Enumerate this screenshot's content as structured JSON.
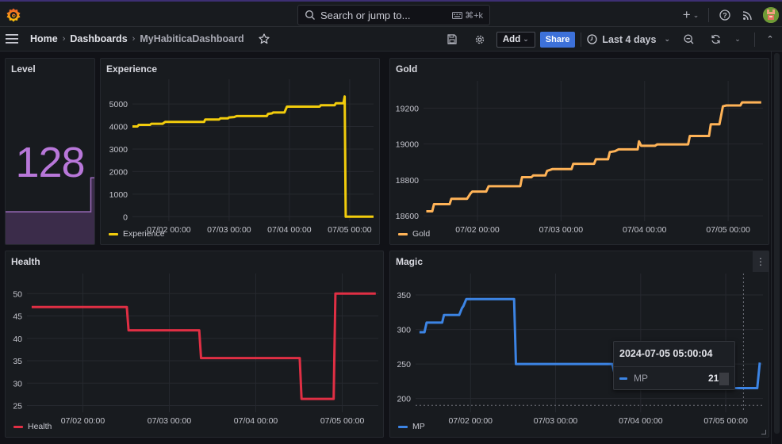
{
  "topbar": {
    "search_placeholder": "Search or jump to...",
    "search_shortcut": "⌘+k",
    "new_button_icon": "plus-icon",
    "help_icon": "help-icon",
    "news_icon": "rss-icon",
    "profile_icon": "avatar"
  },
  "navbar": {
    "breadcrumbs": [
      "Home",
      "Dashboards",
      "MyHabiticaDashboard"
    ],
    "star_icon": "star-icon",
    "add_label": "Add",
    "share_label": "Share",
    "time_range": "Last 4 days"
  },
  "colors": {
    "level": "#b877d9",
    "experience": "#f2cc0c",
    "gold": "#ffb357",
    "health": "#e02f44",
    "magic": "#3c84e4",
    "share_button": "#3d71d9"
  },
  "panels": {
    "level": {
      "title": "Level",
      "value": "128",
      "sparkline": {
        "x_hours": [
          9.5,
          100,
          100,
          105.5
        ],
        "values": [
          127,
          127,
          128,
          128
        ]
      }
    },
    "experience": {
      "title": "Experience",
      "legend": "Experience"
    },
    "gold": {
      "title": "Gold",
      "legend": "Gold"
    },
    "health": {
      "title": "Health",
      "legend": "Health"
    },
    "magic": {
      "title": "Magic",
      "legend": "MP",
      "menu_icon": "kebab-menu-icon"
    }
  },
  "tooltip": {
    "time": "2024-07-05 05:00:04",
    "series": "MP",
    "value": "215"
  },
  "chart_data": [
    {
      "id": "experience",
      "type": "line",
      "title": "Experience",
      "xlabel": "",
      "ylabel": "",
      "x_unit": "hours since 07/01 00:00",
      "xlim": [
        9.5,
        105.5
      ],
      "ylim": [
        -200,
        5600
      ],
      "yticks": [
        0,
        1000,
        2000,
        3000,
        4000,
        5000
      ],
      "xticks": [
        {
          "h": 24,
          "label": "07/02 00:00"
        },
        {
          "h": 48,
          "label": "07/03 00:00"
        },
        {
          "h": 72,
          "label": "07/04 00:00"
        },
        {
          "h": 96,
          "label": "07/05 00:00"
        }
      ],
      "legend": "bottom-left",
      "grid": true,
      "series": [
        {
          "name": "Experience",
          "points": [
            [
              9.5,
              4000
            ],
            [
              11.5,
              4000
            ],
            [
              12,
              4070
            ],
            [
              16.5,
              4070
            ],
            [
              17,
              4120
            ],
            [
              21.5,
              4120
            ],
            [
              22.5,
              4200
            ],
            [
              38,
              4200
            ],
            [
              38.5,
              4310
            ],
            [
              44,
              4310
            ],
            [
              44.5,
              4360
            ],
            [
              47.5,
              4360
            ],
            [
              48,
              4400
            ],
            [
              50,
              4420
            ],
            [
              51,
              4460
            ],
            [
              63,
              4460
            ],
            [
              63.5,
              4560
            ],
            [
              65,
              4580
            ],
            [
              65.5,
              4620
            ],
            [
              70,
              4620
            ],
            [
              71,
              4880
            ],
            [
              84,
              4880
            ],
            [
              84.5,
              4940
            ],
            [
              90,
              4940
            ],
            [
              90.5,
              5030
            ],
            [
              93.5,
              5030
            ],
            [
              94,
              5330
            ],
            [
              94.4,
              0
            ],
            [
              105.5,
              0
            ]
          ]
        }
      ]
    },
    {
      "id": "gold",
      "type": "line",
      "title": "Gold",
      "x_unit": "hours since 07/01 00:00",
      "xlim": [
        8.5,
        106
      ],
      "ylim": [
        18570,
        19290
      ],
      "yticks": [
        18600,
        18800,
        19000,
        19200
      ],
      "xticks": [
        {
          "h": 24,
          "label": "07/02 00:00"
        },
        {
          "h": 48,
          "label": "07/03 00:00"
        },
        {
          "h": 72,
          "label": "07/04 00:00"
        },
        {
          "h": 96,
          "label": "07/05 00:00"
        }
      ],
      "legend": "bottom-left",
      "grid": true,
      "series": [
        {
          "name": "Gold",
          "points": [
            [
              9.3,
              18625
            ],
            [
              11,
              18625
            ],
            [
              11.5,
              18665
            ],
            [
              16,
              18665
            ],
            [
              16.5,
              18695
            ],
            [
              21,
              18695
            ],
            [
              22,
              18725
            ],
            [
              22.5,
              18735
            ],
            [
              26.5,
              18735
            ],
            [
              27.2,
              18765
            ],
            [
              36.3,
              18765
            ],
            [
              36.8,
              18815
            ],
            [
              39.5,
              18815
            ],
            [
              40,
              18825
            ],
            [
              43.5,
              18825
            ],
            [
              44,
              18850
            ],
            [
              45.5,
              18860
            ],
            [
              51,
              18860
            ],
            [
              51.5,
              18890
            ],
            [
              57.5,
              18890
            ],
            [
              58,
              18915
            ],
            [
              61.5,
              18915
            ],
            [
              62,
              18955
            ],
            [
              63.5,
              18960
            ],
            [
              64.5,
              18970
            ],
            [
              70,
              18970
            ],
            [
              70.4,
              19015
            ],
            [
              71,
              18990
            ],
            [
              75,
              18990
            ],
            [
              75.6,
              18998
            ],
            [
              84.5,
              18998
            ],
            [
              85,
              19045
            ],
            [
              90.5,
              19045
            ],
            [
              91,
              19110
            ],
            [
              93.5,
              19110
            ],
            [
              94.5,
              19210
            ],
            [
              95.5,
              19215
            ],
            [
              99.5,
              19215
            ],
            [
              100,
              19232
            ],
            [
              105.5,
              19232
            ]
          ]
        }
      ]
    },
    {
      "id": "health",
      "type": "line",
      "title": "Health",
      "x_unit": "hours since 07/01 00:00",
      "xlim": [
        8.5,
        106
      ],
      "ylim": [
        23.5,
        52
      ],
      "yticks": [
        25,
        30,
        35,
        40,
        45,
        50
      ],
      "xticks": [
        {
          "h": 24,
          "label": "07/02 00:00"
        },
        {
          "h": 48,
          "label": "07/03 00:00"
        },
        {
          "h": 72,
          "label": "07/04 00:00"
        },
        {
          "h": 96,
          "label": "07/05 00:00"
        }
      ],
      "legend": "bottom-left",
      "grid": true,
      "series": [
        {
          "name": "Health",
          "points": [
            [
              9.8,
              47
            ],
            [
              36.2,
              47
            ],
            [
              36.7,
              41.8
            ],
            [
              56.3,
              41.8
            ],
            [
              56.8,
              35.6
            ],
            [
              84.2,
              35.6
            ],
            [
              84.7,
              26.5
            ],
            [
              93.6,
              26.5
            ],
            [
              94.1,
              50
            ],
            [
              105.3,
              50
            ]
          ]
        }
      ]
    },
    {
      "id": "magic",
      "type": "line",
      "title": "Magic",
      "x_unit": "hours since 07/01 00:00",
      "xlim": [
        8.5,
        106.5
      ],
      "ylim": [
        180,
        365
      ],
      "yticks": [
        200,
        250,
        300,
        350
      ],
      "xticks": [
        {
          "h": 24,
          "label": "07/02 00:00"
        },
        {
          "h": 48,
          "label": "07/03 00:00"
        },
        {
          "h": 72,
          "label": "07/04 00:00"
        },
        {
          "h": 96,
          "label": "07/05 00:00"
        }
      ],
      "legend": "bottom-left",
      "grid": true,
      "crosshair": {
        "h": 101,
        "value": 190
      },
      "series": [
        {
          "name": "MP",
          "points": [
            [
              9.6,
              296
            ],
            [
              11,
              296
            ],
            [
              11.6,
              310
            ],
            [
              16,
              310
            ],
            [
              16.5,
              321
            ],
            [
              20.8,
              321
            ],
            [
              21.6,
              331
            ],
            [
              22,
              334
            ],
            [
              22.8,
              344
            ],
            [
              36.3,
              344
            ],
            [
              36.8,
              250
            ],
            [
              64,
              250
            ],
            [
              64.6,
              237
            ],
            [
              70,
              237
            ],
            [
              70.5,
              215
            ],
            [
              104.9,
              215
            ],
            [
              105.6,
              252
            ]
          ]
        }
      ]
    }
  ]
}
